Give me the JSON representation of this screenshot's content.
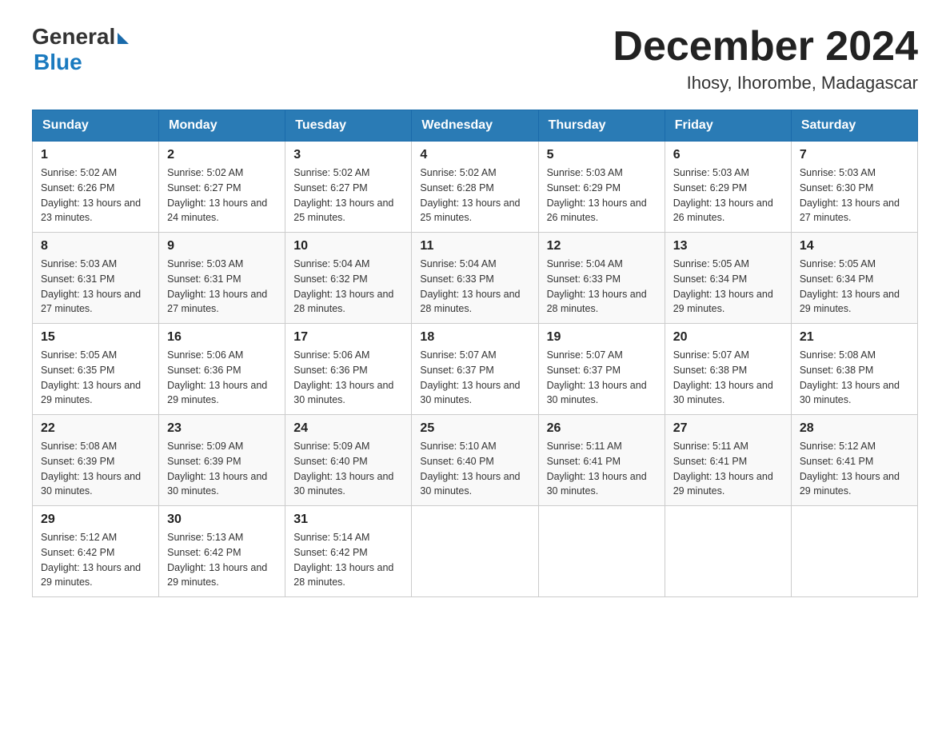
{
  "logo": {
    "general": "General",
    "blue": "Blue"
  },
  "title": "December 2024",
  "location": "Ihosy, Ihorombe, Madagascar",
  "days": [
    "Sunday",
    "Monday",
    "Tuesday",
    "Wednesday",
    "Thursday",
    "Friday",
    "Saturday"
  ],
  "weeks": [
    [
      {
        "day": "1",
        "sunrise": "5:02 AM",
        "sunset": "6:26 PM",
        "daylight": "13 hours and 23 minutes."
      },
      {
        "day": "2",
        "sunrise": "5:02 AM",
        "sunset": "6:27 PM",
        "daylight": "13 hours and 24 minutes."
      },
      {
        "day": "3",
        "sunrise": "5:02 AM",
        "sunset": "6:27 PM",
        "daylight": "13 hours and 25 minutes."
      },
      {
        "day": "4",
        "sunrise": "5:02 AM",
        "sunset": "6:28 PM",
        "daylight": "13 hours and 25 minutes."
      },
      {
        "day": "5",
        "sunrise": "5:03 AM",
        "sunset": "6:29 PM",
        "daylight": "13 hours and 26 minutes."
      },
      {
        "day": "6",
        "sunrise": "5:03 AM",
        "sunset": "6:29 PM",
        "daylight": "13 hours and 26 minutes."
      },
      {
        "day": "7",
        "sunrise": "5:03 AM",
        "sunset": "6:30 PM",
        "daylight": "13 hours and 27 minutes."
      }
    ],
    [
      {
        "day": "8",
        "sunrise": "5:03 AM",
        "sunset": "6:31 PM",
        "daylight": "13 hours and 27 minutes."
      },
      {
        "day": "9",
        "sunrise": "5:03 AM",
        "sunset": "6:31 PM",
        "daylight": "13 hours and 27 minutes."
      },
      {
        "day": "10",
        "sunrise": "5:04 AM",
        "sunset": "6:32 PM",
        "daylight": "13 hours and 28 minutes."
      },
      {
        "day": "11",
        "sunrise": "5:04 AM",
        "sunset": "6:33 PM",
        "daylight": "13 hours and 28 minutes."
      },
      {
        "day": "12",
        "sunrise": "5:04 AM",
        "sunset": "6:33 PM",
        "daylight": "13 hours and 28 minutes."
      },
      {
        "day": "13",
        "sunrise": "5:05 AM",
        "sunset": "6:34 PM",
        "daylight": "13 hours and 29 minutes."
      },
      {
        "day": "14",
        "sunrise": "5:05 AM",
        "sunset": "6:34 PM",
        "daylight": "13 hours and 29 minutes."
      }
    ],
    [
      {
        "day": "15",
        "sunrise": "5:05 AM",
        "sunset": "6:35 PM",
        "daylight": "13 hours and 29 minutes."
      },
      {
        "day": "16",
        "sunrise": "5:06 AM",
        "sunset": "6:36 PM",
        "daylight": "13 hours and 29 minutes."
      },
      {
        "day": "17",
        "sunrise": "5:06 AM",
        "sunset": "6:36 PM",
        "daylight": "13 hours and 30 minutes."
      },
      {
        "day": "18",
        "sunrise": "5:07 AM",
        "sunset": "6:37 PM",
        "daylight": "13 hours and 30 minutes."
      },
      {
        "day": "19",
        "sunrise": "5:07 AM",
        "sunset": "6:37 PM",
        "daylight": "13 hours and 30 minutes."
      },
      {
        "day": "20",
        "sunrise": "5:07 AM",
        "sunset": "6:38 PM",
        "daylight": "13 hours and 30 minutes."
      },
      {
        "day": "21",
        "sunrise": "5:08 AM",
        "sunset": "6:38 PM",
        "daylight": "13 hours and 30 minutes."
      }
    ],
    [
      {
        "day": "22",
        "sunrise": "5:08 AM",
        "sunset": "6:39 PM",
        "daylight": "13 hours and 30 minutes."
      },
      {
        "day": "23",
        "sunrise": "5:09 AM",
        "sunset": "6:39 PM",
        "daylight": "13 hours and 30 minutes."
      },
      {
        "day": "24",
        "sunrise": "5:09 AM",
        "sunset": "6:40 PM",
        "daylight": "13 hours and 30 minutes."
      },
      {
        "day": "25",
        "sunrise": "5:10 AM",
        "sunset": "6:40 PM",
        "daylight": "13 hours and 30 minutes."
      },
      {
        "day": "26",
        "sunrise": "5:11 AM",
        "sunset": "6:41 PM",
        "daylight": "13 hours and 30 minutes."
      },
      {
        "day": "27",
        "sunrise": "5:11 AM",
        "sunset": "6:41 PM",
        "daylight": "13 hours and 29 minutes."
      },
      {
        "day": "28",
        "sunrise": "5:12 AM",
        "sunset": "6:41 PM",
        "daylight": "13 hours and 29 minutes."
      }
    ],
    [
      {
        "day": "29",
        "sunrise": "5:12 AM",
        "sunset": "6:42 PM",
        "daylight": "13 hours and 29 minutes."
      },
      {
        "day": "30",
        "sunrise": "5:13 AM",
        "sunset": "6:42 PM",
        "daylight": "13 hours and 29 minutes."
      },
      {
        "day": "31",
        "sunrise": "5:14 AM",
        "sunset": "6:42 PM",
        "daylight": "13 hours and 28 minutes."
      },
      null,
      null,
      null,
      null
    ]
  ]
}
